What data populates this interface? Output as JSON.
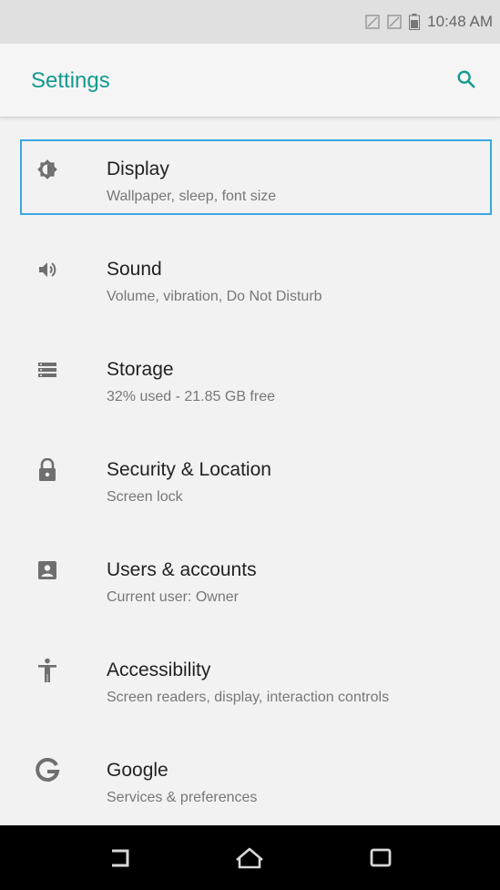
{
  "status_bar": {
    "time": "10:48 AM",
    "icons": [
      "signal-icon",
      "signal-icon",
      "battery-icon"
    ]
  },
  "app_bar": {
    "title": "Settings",
    "search_icon": "search-icon",
    "accent_color": "#139a8f"
  },
  "settings": [
    {
      "title": "Display",
      "subtitle": "Wallpaper, sleep, font size",
      "icon": "brightness-icon",
      "selected": true
    },
    {
      "title": "Sound",
      "subtitle": "Volume, vibration, Do Not Disturb",
      "icon": "volume-icon"
    },
    {
      "title": "Storage",
      "subtitle": "32% used - 21.85 GB free",
      "icon": "storage-icon"
    },
    {
      "title": "Security & Location",
      "subtitle": "Screen lock",
      "icon": "lock-icon"
    },
    {
      "title": "Users & accounts",
      "subtitle": "Current user: Owner",
      "icon": "account-icon"
    },
    {
      "title": "Accessibility",
      "subtitle": "Screen readers, display, interaction controls",
      "icon": "accessibility-icon"
    },
    {
      "title": "Google",
      "subtitle": "Services & preferences",
      "icon": "google-icon"
    }
  ],
  "nav_bar": {
    "buttons": [
      "back-icon",
      "home-icon",
      "recents-icon"
    ]
  }
}
